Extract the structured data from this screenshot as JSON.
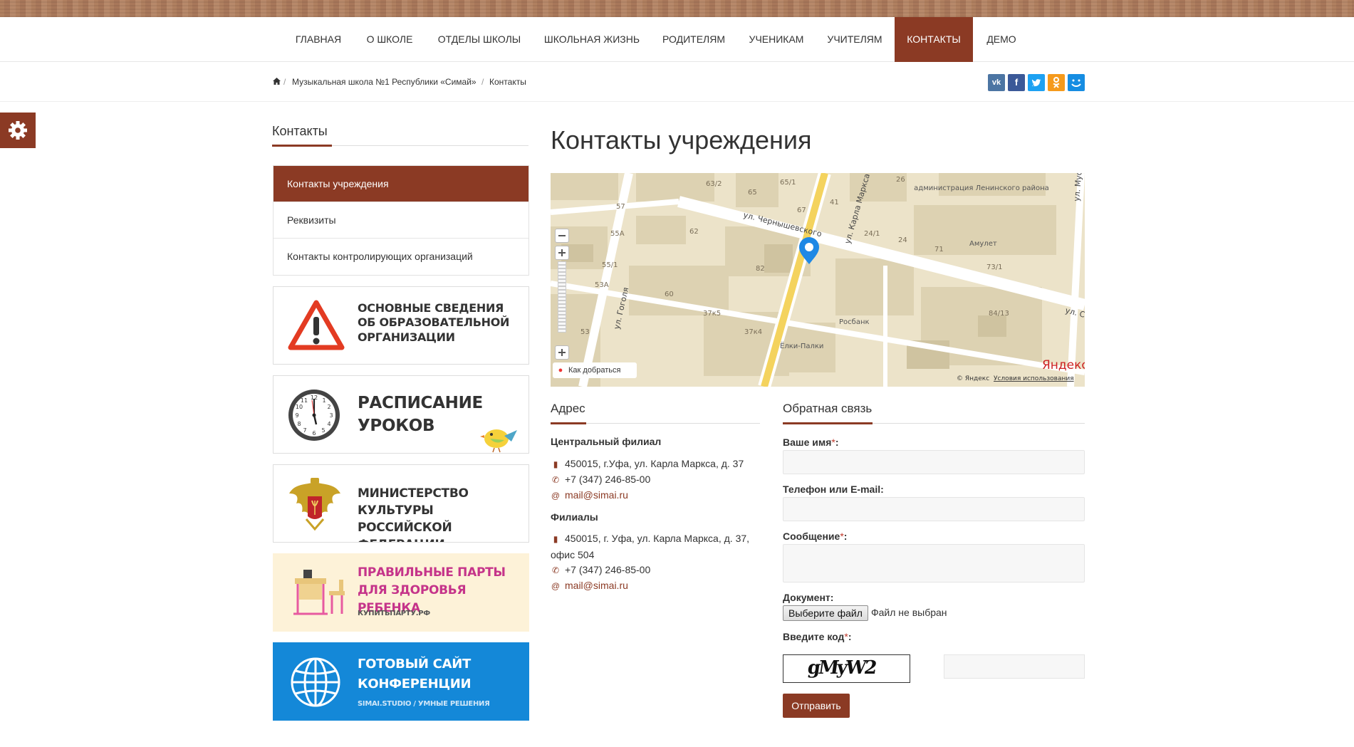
{
  "nav": {
    "items": [
      "Главная",
      "О школе",
      "Отделы школы",
      "Школьная жизнь",
      "Родителям",
      "Ученикам",
      "Учителям",
      "Контакты",
      "Демо"
    ],
    "active": "Контакты"
  },
  "breadcrumb": {
    "items": [
      "Музыкальная школа №1 Республики «Симай»",
      "Контакты"
    ],
    "separator": "/"
  },
  "social": {
    "icons": [
      "vk-icon",
      "facebook-icon",
      "twitter-icon",
      "odnoklassniki-icon",
      "moimir-icon"
    ]
  },
  "sidebar": {
    "title": "Контакты",
    "items": [
      {
        "label": "Контакты учреждения",
        "active": true
      },
      {
        "label": "Реквизиты",
        "active": false
      },
      {
        "label": "Контакты контролирующих организаций",
        "active": false
      }
    ]
  },
  "banners": {
    "info": [
      "Основные сведения",
      "об образовательной",
      "организации"
    ],
    "schedule": [
      "Расписание",
      "уроков"
    ],
    "ministry": [
      "Министерство культуры",
      "Российской федерации"
    ],
    "desks": [
      "Правильные парты",
      "для здоровья ребенка",
      "КУПИТЬПАРТУ.РФ"
    ],
    "site": [
      "Готовый сайт",
      "конференции",
      "SIMAI.STUDIO / УМНЫЕ РЕШЕНИЯ"
    ]
  },
  "main": {
    "title": "Контакты учреждения"
  },
  "map": {
    "streets": [
      "ул. Чернышевского",
      "ул. Карла Маркса",
      "ул. Гоголя",
      "ул. Мус",
      "ул. С"
    ],
    "numbers": [
      "63/2",
      "65",
      "65/1",
      "26",
      "57",
      "67",
      "41",
      "55А",
      "62",
      "24/1",
      "24",
      "71",
      "55/1",
      "82",
      "73/1",
      "53А",
      "60",
      "37к5",
      "84/13",
      "53",
      "37к4"
    ],
    "poi": [
      "администрация Ленинского района",
      "Амулет",
      "Росбанк",
      "Ёлки-Палки"
    ],
    "route_label": "Как добраться",
    "copyright": "© Яндекс",
    "terms": "Условия использования",
    "brand": "Яндекс"
  },
  "address": {
    "title": "Адрес",
    "central_title": "Центральный филиал",
    "central_address": "450015, г.Уфа, ул. Карла Маркса, д. 37",
    "central_phone": "+7 (347) 246-85-00",
    "central_email": "mail@simai.ru",
    "branches_title": "Филиалы",
    "branch_address": "450015, г. Уфа, ул. Карла Маркса, д. 37, офис 504",
    "branch_phone": "+7 (347) 246-85-00",
    "branch_email": "mail@simai.ru"
  },
  "feedback": {
    "title": "Обратная связь",
    "name_label": "Ваше имя",
    "contact_label": "Телефон или E-mail:",
    "message_label": "Сообщение",
    "document_label": "Документ:",
    "file_button": "Выберите файл",
    "file_status": "Файл не выбран",
    "code_label": "Введите код",
    "captcha_text": "gMyW2",
    "submit": "Отправить",
    "required_mark": "*"
  },
  "colors": {
    "accent": "#8b3a24",
    "vk": "#4c75a3",
    "facebook": "#3b5998",
    "twitter": "#1da1f2",
    "ok": "#f59a1c",
    "moimir": "#168de2"
  }
}
